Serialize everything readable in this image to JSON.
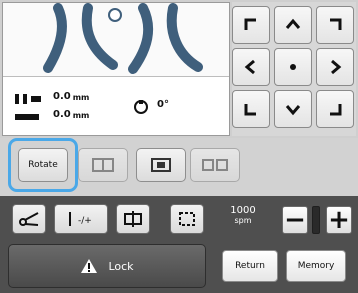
{
  "info": {
    "height_value": "0.0",
    "height_unit": "mm",
    "width_value": "0.0",
    "width_unit": "mm",
    "angle_value": "0°"
  },
  "edit_buttons": {
    "rotate_label": "Rotate"
  },
  "speed": {
    "value": "1000",
    "unit": "spm"
  },
  "speed_controls": {
    "minus_label": "−",
    "plus_label": "+"
  },
  "lock": {
    "label": "Lock"
  },
  "buttons": {
    "return_label": "Return",
    "memory_label": "Memory"
  },
  "icons": {
    "arrows": [
      "corner-top-left-icon",
      "arrow-up-icon",
      "corner-top-right-icon",
      "arrow-left-icon",
      "center-dot-icon",
      "arrow-right-icon",
      "corner-bottom-left-icon",
      "arrow-down-icon",
      "corner-bottom-right-icon"
    ],
    "tools": [
      "scissors-icon",
      "thread-tension-icon",
      "frame-move-icon",
      "trial-icon"
    ],
    "warning": "warning-triangle-icon"
  },
  "colors": {
    "highlight": "#4aa8e8",
    "bottom_bg": "#4f4f4f"
  }
}
